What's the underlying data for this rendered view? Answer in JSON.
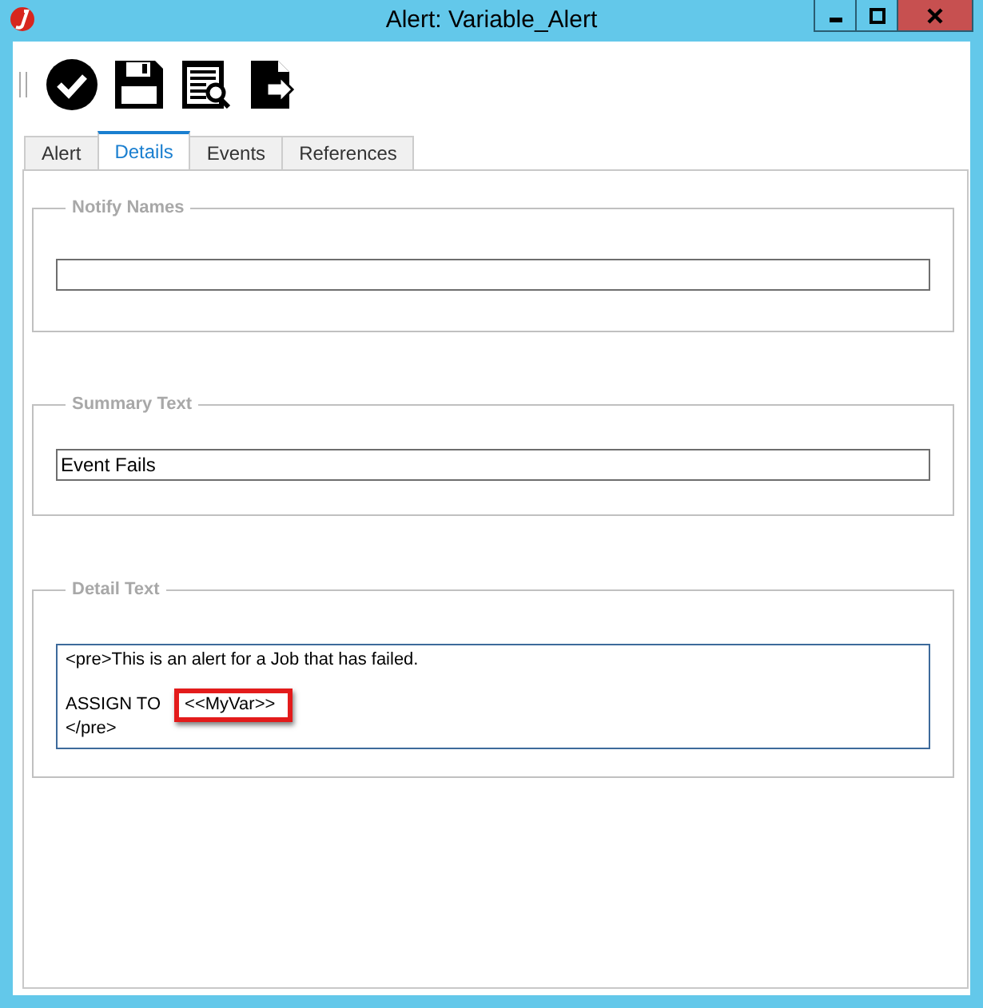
{
  "window": {
    "title": "Alert: Variable_Alert"
  },
  "toolbar": [
    {
      "kind": "check"
    },
    {
      "kind": "save"
    },
    {
      "kind": "preview"
    },
    {
      "kind": "export"
    }
  ],
  "tabs": [
    {
      "label": "Alert",
      "selected": false
    },
    {
      "label": "Details",
      "selected": true
    },
    {
      "label": "Events",
      "selected": false
    },
    {
      "label": "References",
      "selected": false
    }
  ],
  "notify_names": {
    "label": "Notify Names"
  },
  "summary_text": {
    "label": "Summary Text",
    "value": "Event Fails"
  },
  "detail_text": {
    "label": "Detail Text",
    "lines": [
      {
        "parts": [
          {
            "text": "<pre>This is an alert for a Job that has failed.",
            "highlighted": false
          }
        ]
      },
      {
        "blank": true
      },
      {
        "parts": [
          {
            "text": "ASSIGN TO",
            "highlighted": false
          },
          {
            "text": "<<MyVar>>",
            "highlighted": true
          }
        ]
      },
      {
        "parts": [
          {
            "text": "</pre>",
            "highlighted": false
          }
        ]
      }
    ]
  }
}
